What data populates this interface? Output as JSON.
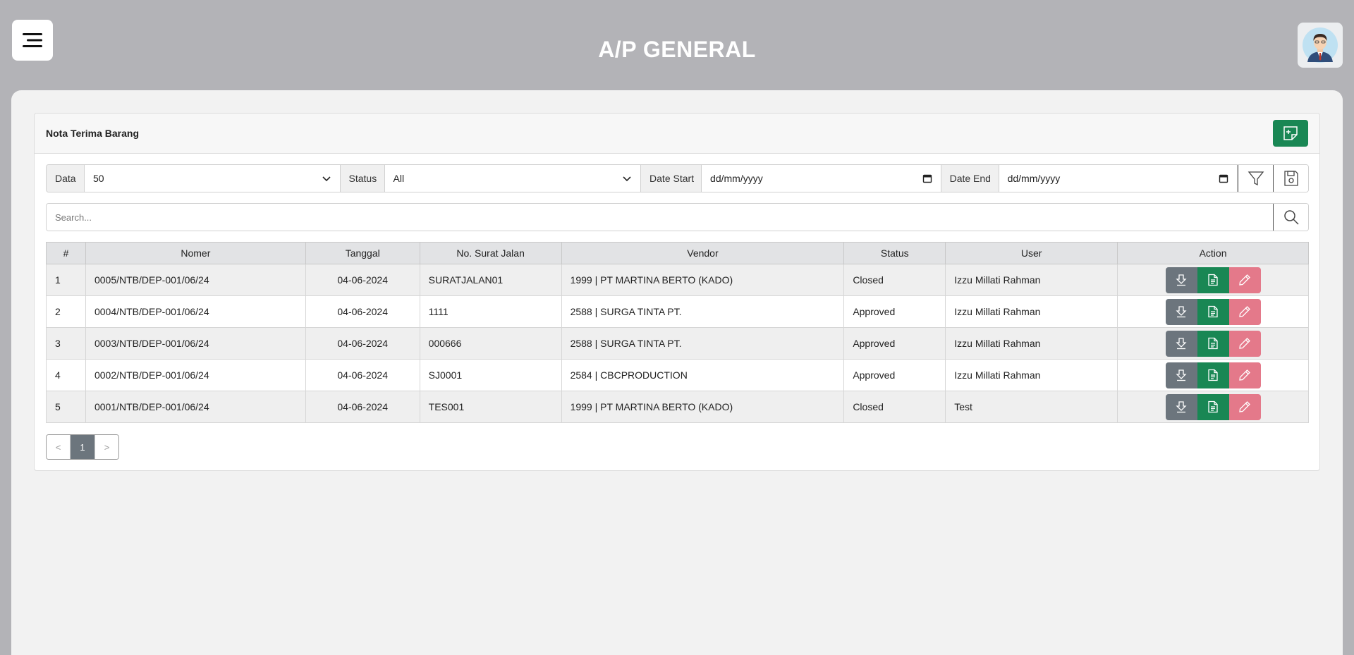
{
  "header": {
    "title": "A/P GENERAL",
    "menu_icon": "hamburger-icon",
    "avatar_icon": "user-avatar-icon"
  },
  "card": {
    "title": "Nota Terima Barang",
    "new_button_icon": "new-note-icon"
  },
  "filters": {
    "data_label": "Data",
    "data_value": "50",
    "status_label": "Status",
    "status_value": "All",
    "date_start_label": "Date Start",
    "date_start_value": "dd/mm/yyyy",
    "date_end_label": "Date End",
    "date_end_value": "dd/mm/yyyy",
    "filter_icon": "filter-icon",
    "save_icon": "save-icon"
  },
  "search": {
    "placeholder": "Search...",
    "icon": "search-icon"
  },
  "table": {
    "columns": [
      "#",
      "Nomer",
      "Tanggal",
      "No. Surat Jalan",
      "Vendor",
      "Status",
      "User",
      "Action"
    ],
    "rows": [
      {
        "no": "1",
        "nomer": "0005/NTB/DEP-001/06/24",
        "tanggal": "04-06-2024",
        "surat_jalan": "SURATJALAN01",
        "vendor": "1999 | PT MARTINA BERTO (KADO)",
        "status": "Closed",
        "user": "Izzu Millati Rahman"
      },
      {
        "no": "2",
        "nomer": "0004/NTB/DEP-001/06/24",
        "tanggal": "04-06-2024",
        "surat_jalan": "1111",
        "vendor": "2588 | SURGA TINTA PT.",
        "status": "Approved",
        "user": "Izzu Millati Rahman"
      },
      {
        "no": "3",
        "nomer": "0003/NTB/DEP-001/06/24",
        "tanggal": "04-06-2024",
        "surat_jalan": "000666",
        "vendor": "2588 | SURGA TINTA PT.",
        "status": "Approved",
        "user": "Izzu Millati Rahman"
      },
      {
        "no": "4",
        "nomer": "0002/NTB/DEP-001/06/24",
        "tanggal": "04-06-2024",
        "surat_jalan": "SJ0001",
        "vendor": "2584 | CBCPRODUCTION",
        "status": "Approved",
        "user": "Izzu Millati Rahman"
      },
      {
        "no": "5",
        "nomer": "0001/NTB/DEP-001/06/24",
        "tanggal": "04-06-2024",
        "surat_jalan": "TES001",
        "vendor": "1999 | PT MARTINA BERTO (KADO)",
        "status": "Closed",
        "user": "Test"
      }
    ],
    "action_icons": [
      "download-icon",
      "document-icon",
      "edit-icon"
    ]
  },
  "pagination": {
    "prev": "<",
    "current": "1",
    "next": ">"
  },
  "colors": {
    "header_bg": "#b3b3b7",
    "green": "#198754",
    "gray_button": "#6c757d",
    "pink_button": "#e4798a"
  }
}
